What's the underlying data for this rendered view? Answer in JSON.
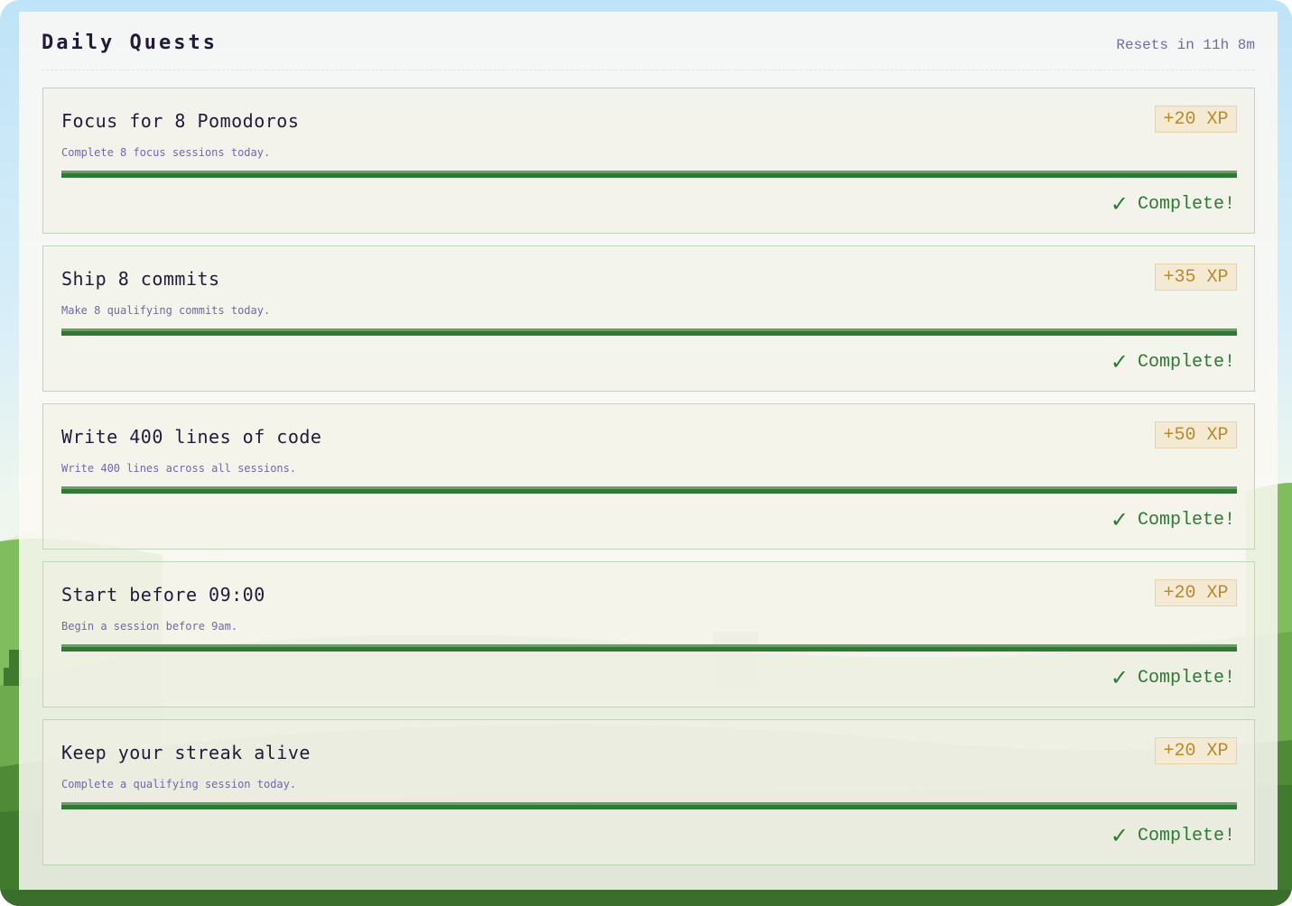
{
  "header": {
    "title": "Daily Quests",
    "reset_text": "Resets in 11h 8m"
  },
  "quests": [
    {
      "title": "Focus for 8 Pomodoros",
      "description": "Complete 8 focus sessions today.",
      "xp": "+20 XP",
      "progress": 1.0,
      "status": "Complete!"
    },
    {
      "title": "Ship 8 commits",
      "description": "Make 8 qualifying commits today.",
      "xp": "+35 XP",
      "progress": 1.0,
      "status": "Complete!"
    },
    {
      "title": "Write 400 lines of code",
      "description": "Write 400 lines across all sessions.",
      "xp": "+50 XP",
      "progress": 1.0,
      "status": "Complete!"
    },
    {
      "title": "Start before 09:00",
      "description": "Begin a session before 9am.",
      "xp": "+20 XP",
      "progress": 1.0,
      "status": "Complete!"
    },
    {
      "title": "Keep your streak alive",
      "description": "Complete a qualifying session today.",
      "xp": "+20 XP",
      "progress": 1.0,
      "status": "Complete!"
    }
  ],
  "icons": {
    "check": "check-icon"
  },
  "colors": {
    "accent_green": "#2e7a35",
    "xp_gold": "#b88a2f",
    "title_ink": "#231a3a",
    "muted_purple": "#7467a8"
  }
}
